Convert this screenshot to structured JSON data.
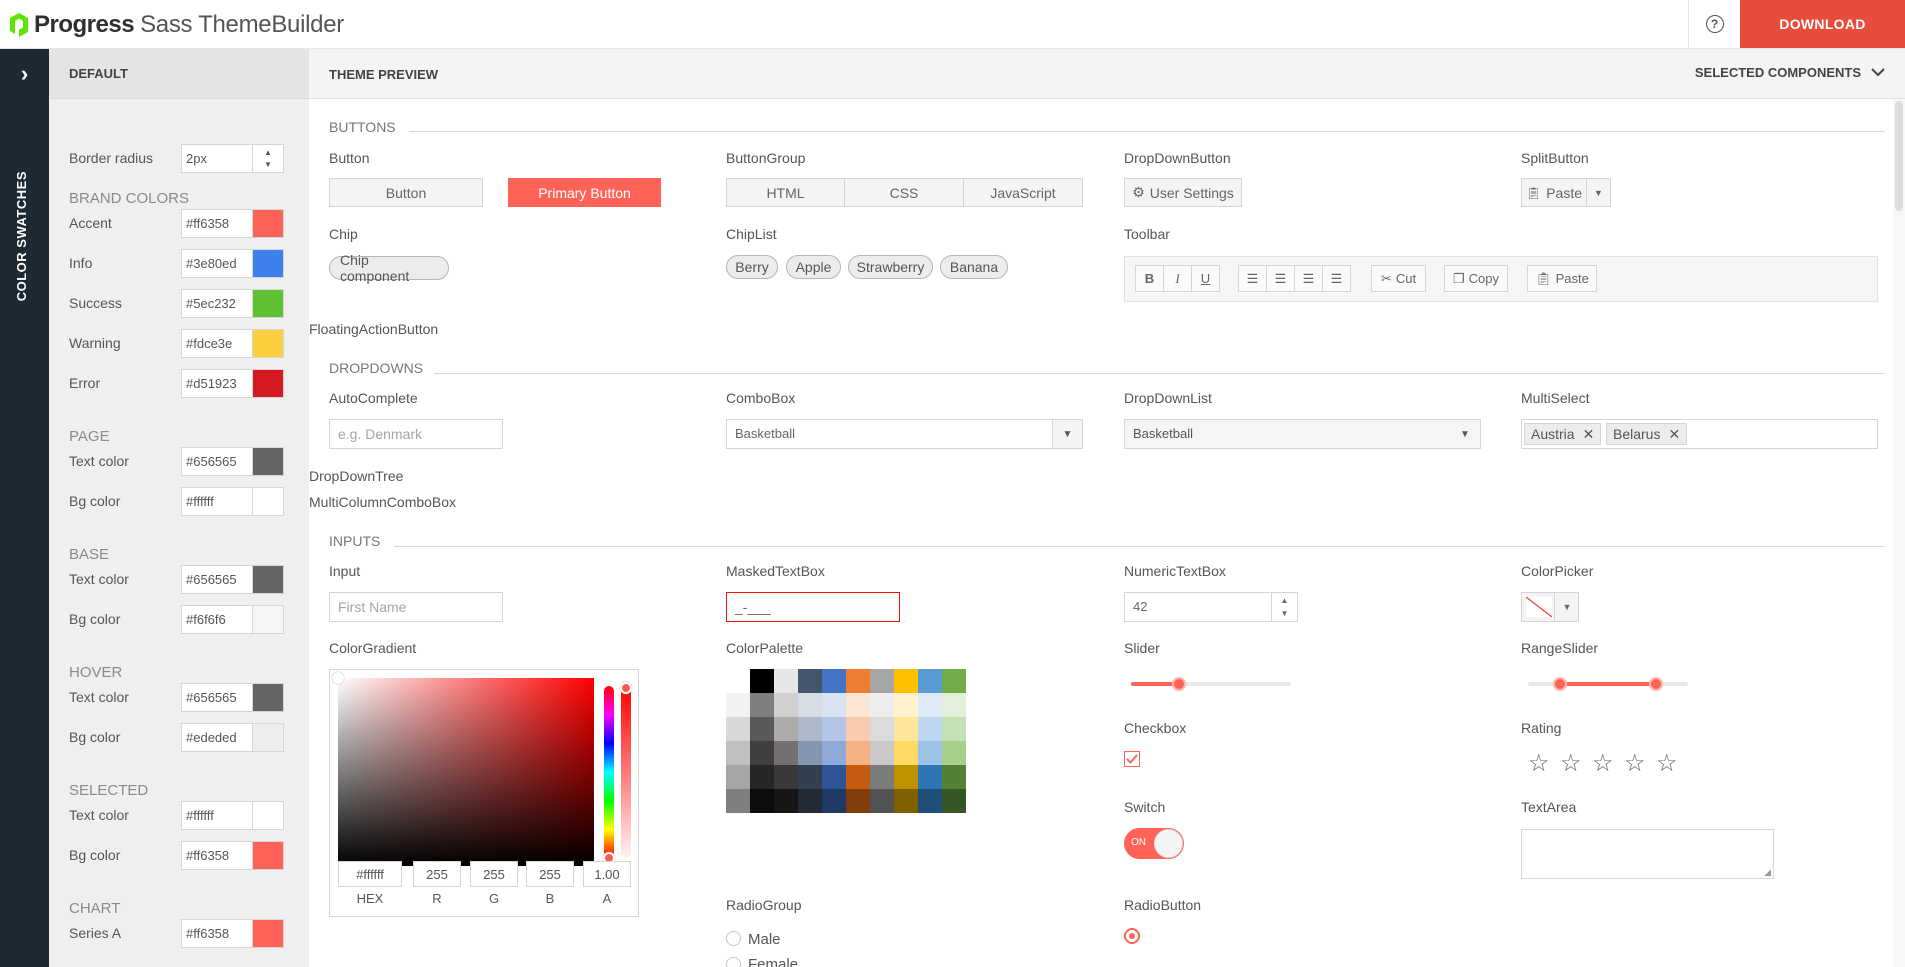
{
  "header": {
    "brand": "Progress",
    "product": "Sass ThemeBuilder",
    "help_icon": "question-circle-icon",
    "download_label": "DOWNLOAD"
  },
  "rail": {
    "toggle_icon": "chevron-right-icon",
    "label": "COLOR SWATCHES"
  },
  "panel": {
    "title": "DEFAULT",
    "border_radius": {
      "label": "Border radius",
      "value": "2px"
    },
    "sections": [
      {
        "title": "BRAND COLORS",
        "rows": [
          {
            "label": "Accent",
            "value": "#ff6358",
            "color": "#ff6358"
          },
          {
            "label": "Info",
            "value": "#3e80ed",
            "color": "#3e80ed"
          },
          {
            "label": "Success",
            "value": "#5ec232",
            "color": "#5ec232"
          },
          {
            "label": "Warning",
            "value": "#fdce3e",
            "color": "#fdce3e"
          },
          {
            "label": "Error",
            "value": "#d51923",
            "color": "#d51923"
          }
        ]
      },
      {
        "title": "PAGE",
        "rows": [
          {
            "label": "Text color",
            "value": "#656565",
            "color": "#656565"
          },
          {
            "label": "Bg color",
            "value": "#ffffff",
            "color": "#ffffff"
          }
        ]
      },
      {
        "title": "BASE",
        "rows": [
          {
            "label": "Text color",
            "value": "#656565",
            "color": "#656565"
          },
          {
            "label": "Bg color",
            "value": "#f6f6f6",
            "color": "#f6f6f6"
          }
        ]
      },
      {
        "title": "HOVER",
        "rows": [
          {
            "label": "Text color",
            "value": "#656565",
            "color": "#656565"
          },
          {
            "label": "Bg color",
            "value": "#ededed",
            "color": "#ededed"
          }
        ]
      },
      {
        "title": "SELECTED",
        "rows": [
          {
            "label": "Text color",
            "value": "#ffffff",
            "color": "#ffffff"
          },
          {
            "label": "Bg color",
            "value": "#ff6358",
            "color": "#ff6358"
          }
        ]
      },
      {
        "title": "CHART",
        "rows": [
          {
            "label": "Series A",
            "value": "#ff6358",
            "color": "#ff6358"
          }
        ]
      }
    ]
  },
  "main": {
    "title": "THEME PREVIEW",
    "selected_components": "SELECTED COMPONENTS",
    "buttons": {
      "section": "BUTTONS",
      "button_label": "Button",
      "button": "Button",
      "primary_button": "Primary Button",
      "buttongroup_label": "ButtonGroup",
      "buttongroup": [
        "HTML",
        "CSS",
        "JavaScript"
      ],
      "dropdownbutton_label": "DropDownButton",
      "dropdownbutton": "User Settings",
      "splitbutton_label": "SplitButton",
      "splitbutton": "Paste",
      "chip_label": "Chip",
      "chip": "Chip component",
      "chiplist_label": "ChipList",
      "chiplist": [
        "Berry",
        "Apple",
        "Strawberry",
        "Banana"
      ],
      "toolbar_label": "Toolbar",
      "toolbar": {
        "bold": "B",
        "italic": "I",
        "underline": "U",
        "cut": "Cut",
        "copy": "Copy",
        "paste": "Paste"
      },
      "fab_label": "FloatingActionButton"
    },
    "dropdowns": {
      "section": "DROPDOWNS",
      "autocomplete_label": "AutoComplete",
      "autocomplete_placeholder": "e.g. Denmark",
      "combobox_label": "ComboBox",
      "combobox_value": "Basketball",
      "dropdownlist_label": "DropDownList",
      "dropdownlist_value": "Basketball",
      "multiselect_label": "MultiSelect",
      "multiselect_tags": [
        "Austria",
        "Belarus"
      ],
      "dropdowntree_label": "DropDownTree",
      "multicolumn_label": "MultiColumnComboBox"
    },
    "inputs": {
      "section": "INPUTS",
      "input_label": "Input",
      "input_placeholder": "First Name",
      "masked_label": "MaskedTextBox",
      "masked_value": "_-___",
      "numeric_label": "NumericTextBox",
      "numeric_value": "42",
      "colorpicker_label": "ColorPicker",
      "colorgradient_label": "ColorGradient",
      "colorgradient": {
        "hex": "#ffffff",
        "r": "255",
        "g": "255",
        "b": "255",
        "a": "1.00",
        "caps": [
          "HEX",
          "R",
          "G",
          "B",
          "A"
        ]
      },
      "colorpalette_label": "ColorPalette",
      "palette_colors": [
        "#ffffff",
        "#000000",
        "#e7e6e6",
        "#44546a",
        "#4472c4",
        "#ed7d31",
        "#a5a5a5",
        "#ffc000",
        "#5b9bd5",
        "#70ad47",
        "#f2f2f2",
        "#7f7f7f",
        "#d0cece",
        "#d6dce4",
        "#d9e2f3",
        "#fbe5d5",
        "#ededed",
        "#fff2cc",
        "#deebf6",
        "#e2efd9",
        "#d8d8d8",
        "#595959",
        "#aeabab",
        "#adb9ca",
        "#b4c6e7",
        "#f7cbac",
        "#dbdbdb",
        "#fee599",
        "#bdd7ee",
        "#c5e0b3",
        "#bfbfbf",
        "#3f3f3f",
        "#757070",
        "#8496b0",
        "#8eaadb",
        "#f4b183",
        "#c9c9c9",
        "#ffd965",
        "#9cc3e5",
        "#a8d08d",
        "#a5a5a5",
        "#262626",
        "#3a3838",
        "#323f4f",
        "#2f5496",
        "#c55a11",
        "#7b7b7b",
        "#bf9000",
        "#2e75b5",
        "#538135",
        "#7f7f7f",
        "#0c0c0c",
        "#171616",
        "#222a35",
        "#1f3864",
        "#833c0b",
        "#525252",
        "#7f6000",
        "#1e4e79",
        "#375623"
      ],
      "slider_label": "Slider",
      "slider_value": 0.3,
      "rangeslider_label": "RangeSlider",
      "rangeslider_values": [
        0.2,
        0.8
      ],
      "checkbox_label": "Checkbox",
      "rating_label": "Rating",
      "rating_stars": 5,
      "switch_label": "Switch",
      "switch_on": "ON",
      "textarea_label": "TextArea",
      "radiogroup_label": "RadioGroup",
      "radiogroup": [
        "Male",
        "Female"
      ],
      "radiobutton_label": "RadioButton"
    }
  }
}
